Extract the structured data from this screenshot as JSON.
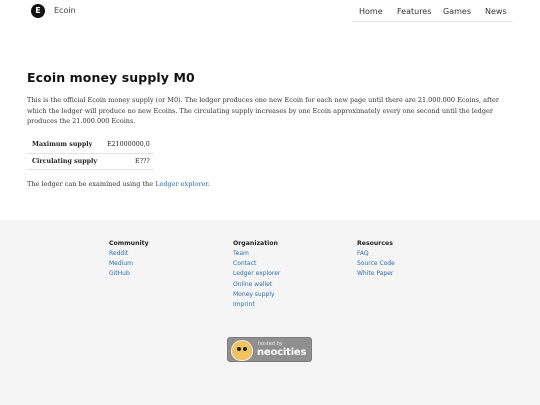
{
  "header": {
    "logo_letter": "E",
    "brand": "Ecoin",
    "nav": [
      "Home",
      "Features",
      "Games",
      "News"
    ]
  },
  "main": {
    "title": "Ecoin money supply M0",
    "intro": "This is the official Ecoin money supply (or M0). The ledger produces one new Ecoin for each new page until there are 21.000.000 Ecoins, after which the ledger will produce no new Ecoins. The circulating supply increases by one Ecoin approximately every one second until the ledger produces the 21.000.000 Ecoins.",
    "supply": [
      {
        "label": "Maximum supply",
        "value": "E21000000,0"
      },
      {
        "label": "Circulating supply",
        "value": "E???"
      }
    ],
    "ledger_note_prefix": "The ledger can be examined using the ",
    "ledger_link": "Ledger explorer",
    "ledger_note_suffix": "."
  },
  "footer": {
    "columns": [
      {
        "heading": "Community",
        "links": [
          "Reddit",
          "Medium",
          "GitHub"
        ]
      },
      {
        "heading": "Organization",
        "links": [
          "Team",
          "Contact",
          "Ledger explorer",
          "Online wallet",
          "Money supply",
          "Imprint"
        ]
      },
      {
        "heading": "Resources",
        "links": [
          "FAQ",
          "Source Code",
          "White Paper"
        ]
      }
    ],
    "badge": {
      "small": "hosted by",
      "big": "neocities"
    }
  }
}
